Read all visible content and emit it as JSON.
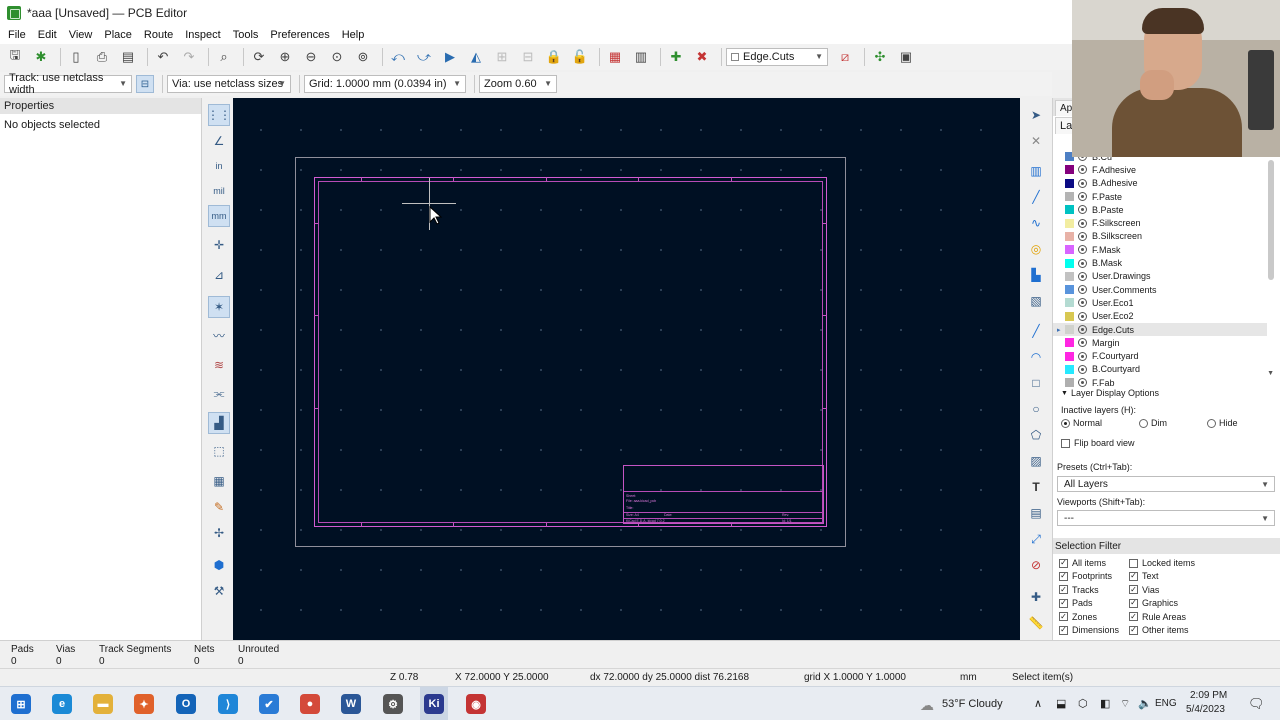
{
  "window": {
    "title": "*aaa [Unsaved] — PCB Editor"
  },
  "menu": [
    "File",
    "Edit",
    "View",
    "Place",
    "Route",
    "Inspect",
    "Tools",
    "Preferences",
    "Help"
  ],
  "toolbar": {
    "layer_select": "Edge.Cuts"
  },
  "toolbar2": {
    "track_width": "Track: use netclass width",
    "via_size": "Via: use netclass sizes",
    "grid": "Grid: 1.0000 mm (0.0394 in)",
    "zoom": "Zoom 0.60"
  },
  "properties": {
    "title": "Properties",
    "status": "No objects selected"
  },
  "left_tools": {
    "units_in": "in",
    "units_mil": "mil",
    "units_mm": "mm"
  },
  "titleblock": {
    "line1": "Sheet:",
    "line2": "File: aaa.kicad_pcb",
    "line3": "Title:",
    "size": "Size: A4",
    "date": "Date:",
    "rev": "Rev:",
    "kicad": "KiCad E.D.A.  kicad 7.0.2",
    "id": "Id: 1/1"
  },
  "appearance": {
    "tab_label": "Appe",
    "subtab_label": "Laye",
    "layers": [
      {
        "name": "B.Cu",
        "color": "#4d7fc4",
        "selected": false
      },
      {
        "name": "F.Adhesive",
        "color": "#84007c",
        "selected": false
      },
      {
        "name": "B.Adhesive",
        "color": "#0b0b84",
        "selected": false
      },
      {
        "name": "F.Paste",
        "color": "#b4b4b4",
        "selected": false
      },
      {
        "name": "B.Paste",
        "color": "#00c2c2",
        "selected": false
      },
      {
        "name": "F.Silkscreen",
        "color": "#f2eda1",
        "selected": false
      },
      {
        "name": "B.Silkscreen",
        "color": "#e8b2a7",
        "selected": false
      },
      {
        "name": "F.Mask",
        "color": "#d864ff",
        "selected": false
      },
      {
        "name": "B.Mask",
        "color": "#02ffee",
        "selected": false
      },
      {
        "name": "User.Drawings",
        "color": "#c2c2c2",
        "selected": false
      },
      {
        "name": "User.Comments",
        "color": "#5994dc",
        "selected": false
      },
      {
        "name": "User.Eco1",
        "color": "#b4dbd2",
        "selected": false
      },
      {
        "name": "User.Eco2",
        "color": "#d8c852",
        "selected": false
      },
      {
        "name": "Edge.Cuts",
        "color": "#d0d2cd",
        "selected": true
      },
      {
        "name": "Margin",
        "color": "#ff26e2",
        "selected": false
      },
      {
        "name": "F.Courtyard",
        "color": "#ff26e2",
        "selected": false
      },
      {
        "name": "B.Courtyard",
        "color": "#26e9ff",
        "selected": false
      },
      {
        "name": "F.Fab",
        "color": "#afafaf",
        "selected": false
      }
    ],
    "display_options_title": "Layer Display Options",
    "inactive_label": "Inactive layers (H):",
    "inactive_options": [
      "Normal",
      "Dim",
      "Hide"
    ],
    "inactive_selected": "Normal",
    "flip_board_label": "Flip board view",
    "presets_label": "Presets (Ctrl+Tab):",
    "presets_value": "All Layers",
    "viewports_label": "Viewports (Shift+Tab):",
    "viewports_value": "---"
  },
  "selection_filter": {
    "title": "Selection Filter",
    "items": [
      {
        "label": "All items",
        "checked": true
      },
      {
        "label": "Locked items",
        "checked": false
      },
      {
        "label": "Footprints",
        "checked": true
      },
      {
        "label": "Text",
        "checked": true
      },
      {
        "label": "Tracks",
        "checked": true
      },
      {
        "label": "Vias",
        "checked": true
      },
      {
        "label": "Pads",
        "checked": true
      },
      {
        "label": "Graphics",
        "checked": true
      },
      {
        "label": "Zones",
        "checked": true
      },
      {
        "label": "Rule Areas",
        "checked": true
      },
      {
        "label": "Dimensions",
        "checked": true
      },
      {
        "label": "Other items",
        "checked": true
      }
    ]
  },
  "message_panel": [
    {
      "label": "Pads",
      "value": "0"
    },
    {
      "label": "Vias",
      "value": "0"
    },
    {
      "label": "Track Segments",
      "value": "0"
    },
    {
      "label": "Nets",
      "value": "0"
    },
    {
      "label": "Unrouted",
      "value": "0"
    }
  ],
  "statusbar": {
    "z": "Z 0.78",
    "xy": "X 72.0000  Y 25.0000",
    "delta": "dx 72.0000  dy 25.0000  dist 76.2168",
    "grid": "grid X 1.0000  Y 1.0000",
    "units": "mm",
    "mode": "Select item(s)"
  },
  "taskbar": {
    "weather": "53°F  Cloudy",
    "lang": "ENG",
    "time": "2:09 PM",
    "date": "5/4/2023",
    "apps": [
      {
        "name": "windows-start",
        "color": "#1f6fd0",
        "glyph": "⊞"
      },
      {
        "name": "edge-browser",
        "color": "#1b8ad6",
        "glyph": "e"
      },
      {
        "name": "file-explorer",
        "color": "#e3b13b",
        "glyph": "▬"
      },
      {
        "name": "app-orange",
        "color": "#e0612b",
        "glyph": "✦"
      },
      {
        "name": "outlook",
        "color": "#1464b8",
        "glyph": "O"
      },
      {
        "name": "vscode",
        "color": "#1f86d8",
        "glyph": "⟩"
      },
      {
        "name": "app-blue-check",
        "color": "#2a7bd6",
        "glyph": "✔"
      },
      {
        "name": "chrome",
        "color": "#d44a3a",
        "glyph": "●"
      },
      {
        "name": "word",
        "color": "#2b5797",
        "glyph": "W"
      },
      {
        "name": "settings",
        "color": "#555555",
        "glyph": "⚙"
      },
      {
        "name": "kicad",
        "color": "#2b3a8f",
        "glyph": "Ki"
      },
      {
        "name": "app-red",
        "color": "#c43434",
        "glyph": "◉"
      }
    ]
  }
}
